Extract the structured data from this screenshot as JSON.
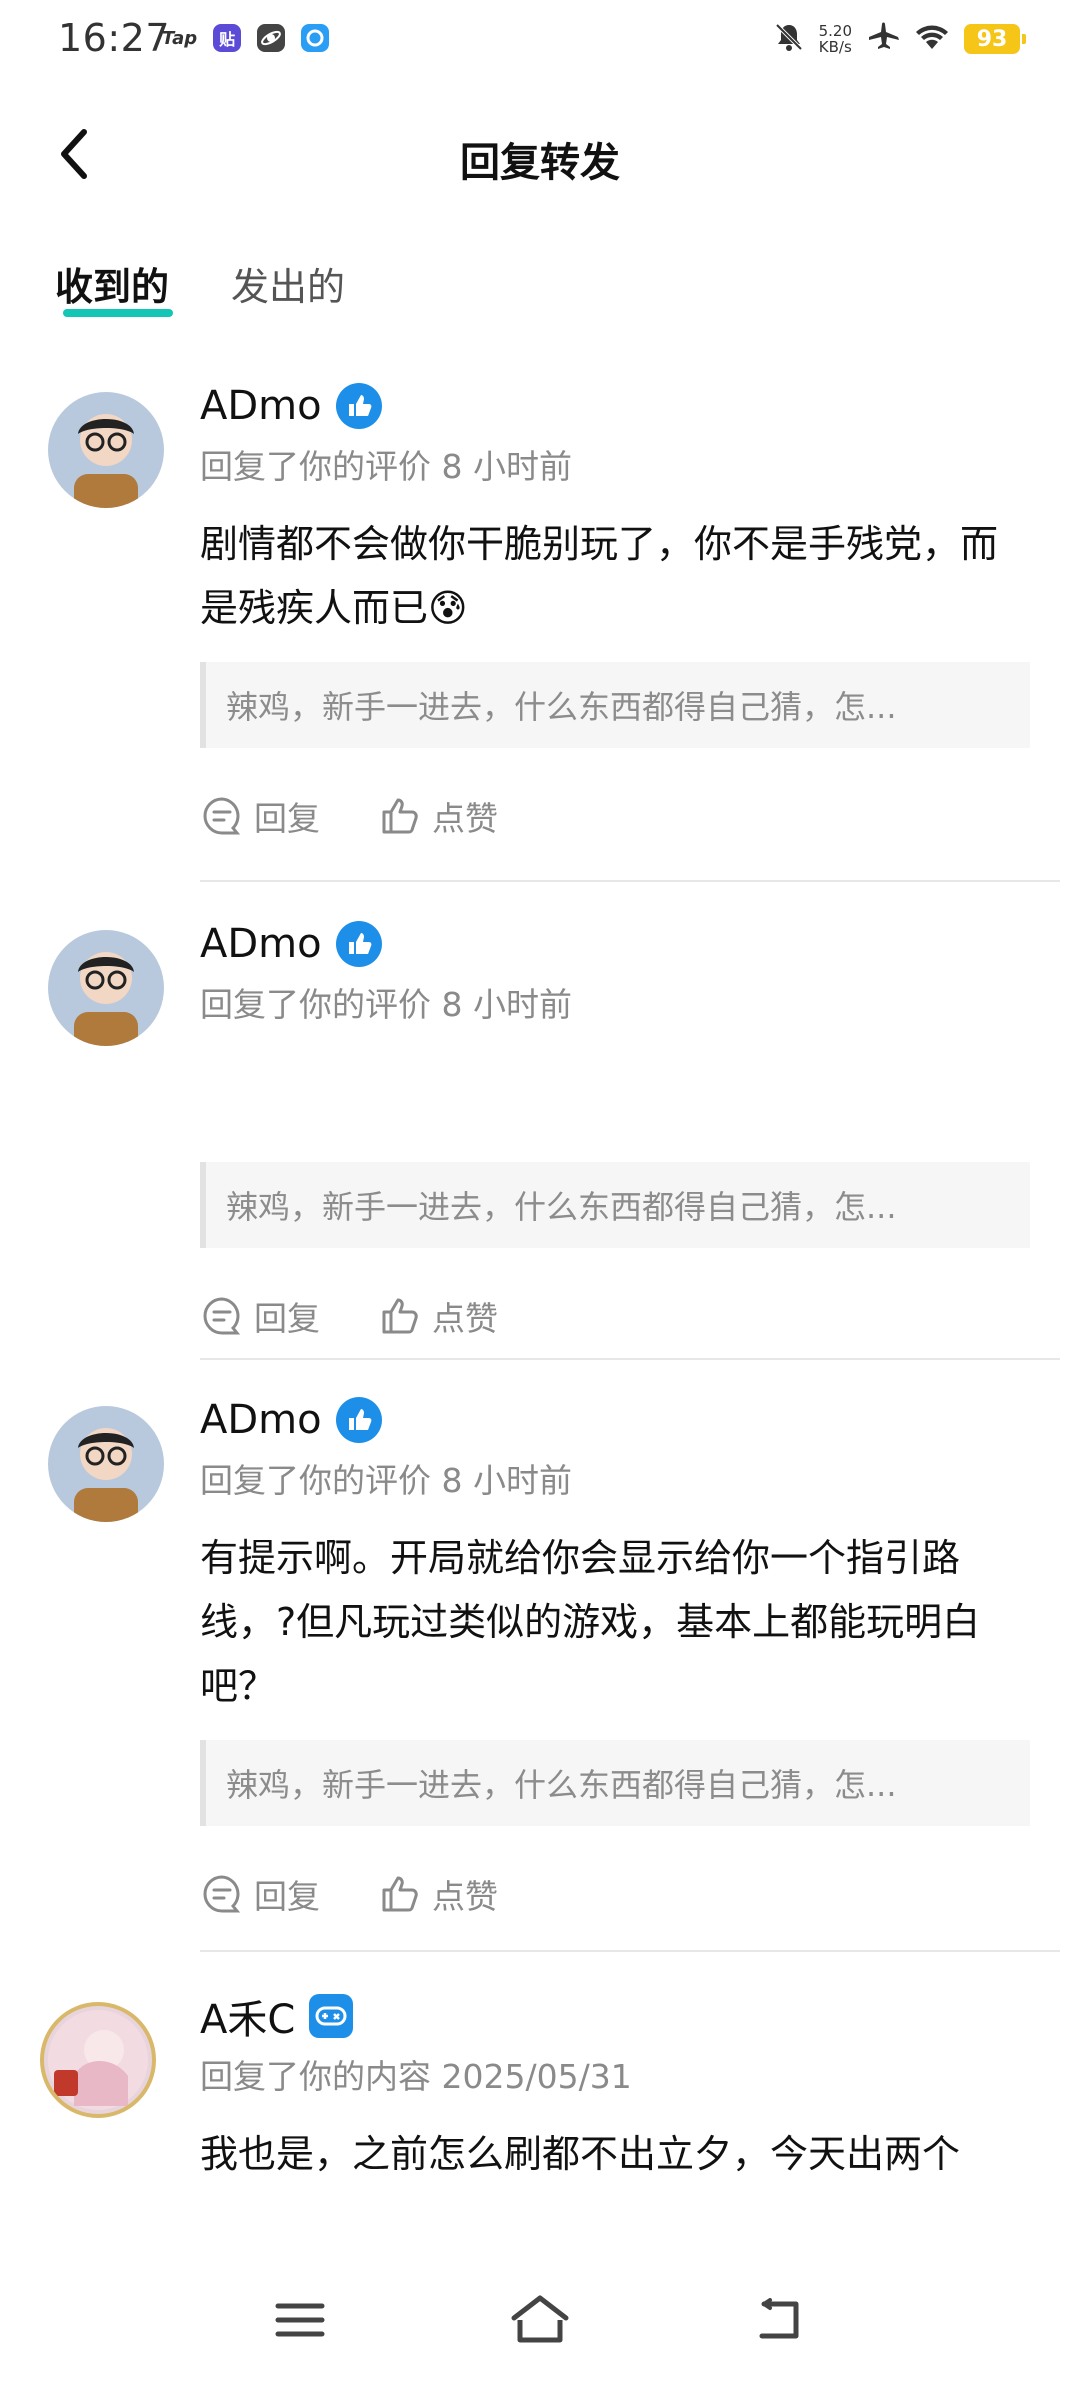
{
  "status_bar": {
    "time": "16:27",
    "app_tap": "Tap",
    "net_speed_value": "5.20",
    "net_speed_unit": "KB/s",
    "battery": "93",
    "accent_battery": "#f5c518"
  },
  "header": {
    "title": "回复转发",
    "back_icon": "chevron-left-icon"
  },
  "tabs": [
    {
      "label": "收到的",
      "active": true
    },
    {
      "label": "发出的",
      "active": false
    }
  ],
  "accent": "#15c5b6",
  "badge_color": "#1d8fe8",
  "items": [
    {
      "username": "ADmo",
      "badge": "thumbs-up-badge-icon",
      "meta": "回复了你的评价 8 小时前",
      "comment": "剧情都不会做你干脆别玩了，你不是手残党，而是残疾人而已😰",
      "quote": "辣鸡，新手一进去，什么东西都得自己猜，怎...",
      "reply_label": "回复",
      "like_label": "点赞"
    },
    {
      "username": "ADmo",
      "badge": "thumbs-up-badge-icon",
      "meta": "回复了你的评价 8 小时前",
      "comment": "",
      "quote": "辣鸡，新手一进去，什么东西都得自己猜，怎...",
      "reply_label": "回复",
      "like_label": "点赞"
    },
    {
      "username": "ADmo",
      "badge": "thumbs-up-badge-icon",
      "meta": "回复了你的评价 8 小时前",
      "comment": "有提示啊。开局就给你会显示给你一个指引路线，?但凡玩过类似的游戏，基本上都能玩明白吧？",
      "quote": "辣鸡，新手一进去，什么东西都得自己猜，怎...",
      "reply_label": "回复",
      "like_label": "点赞"
    },
    {
      "username": "A禾C",
      "badge": "gamepad-badge-icon",
      "meta": "回复了你的内容 2025/05/31",
      "comment": "我也是，之前怎么刷都不出立夕，今天出两个"
    }
  ],
  "nav_bar": {
    "menu_icon": "menu-icon",
    "home_icon": "home-icon",
    "back_icon": "back-return-icon"
  }
}
